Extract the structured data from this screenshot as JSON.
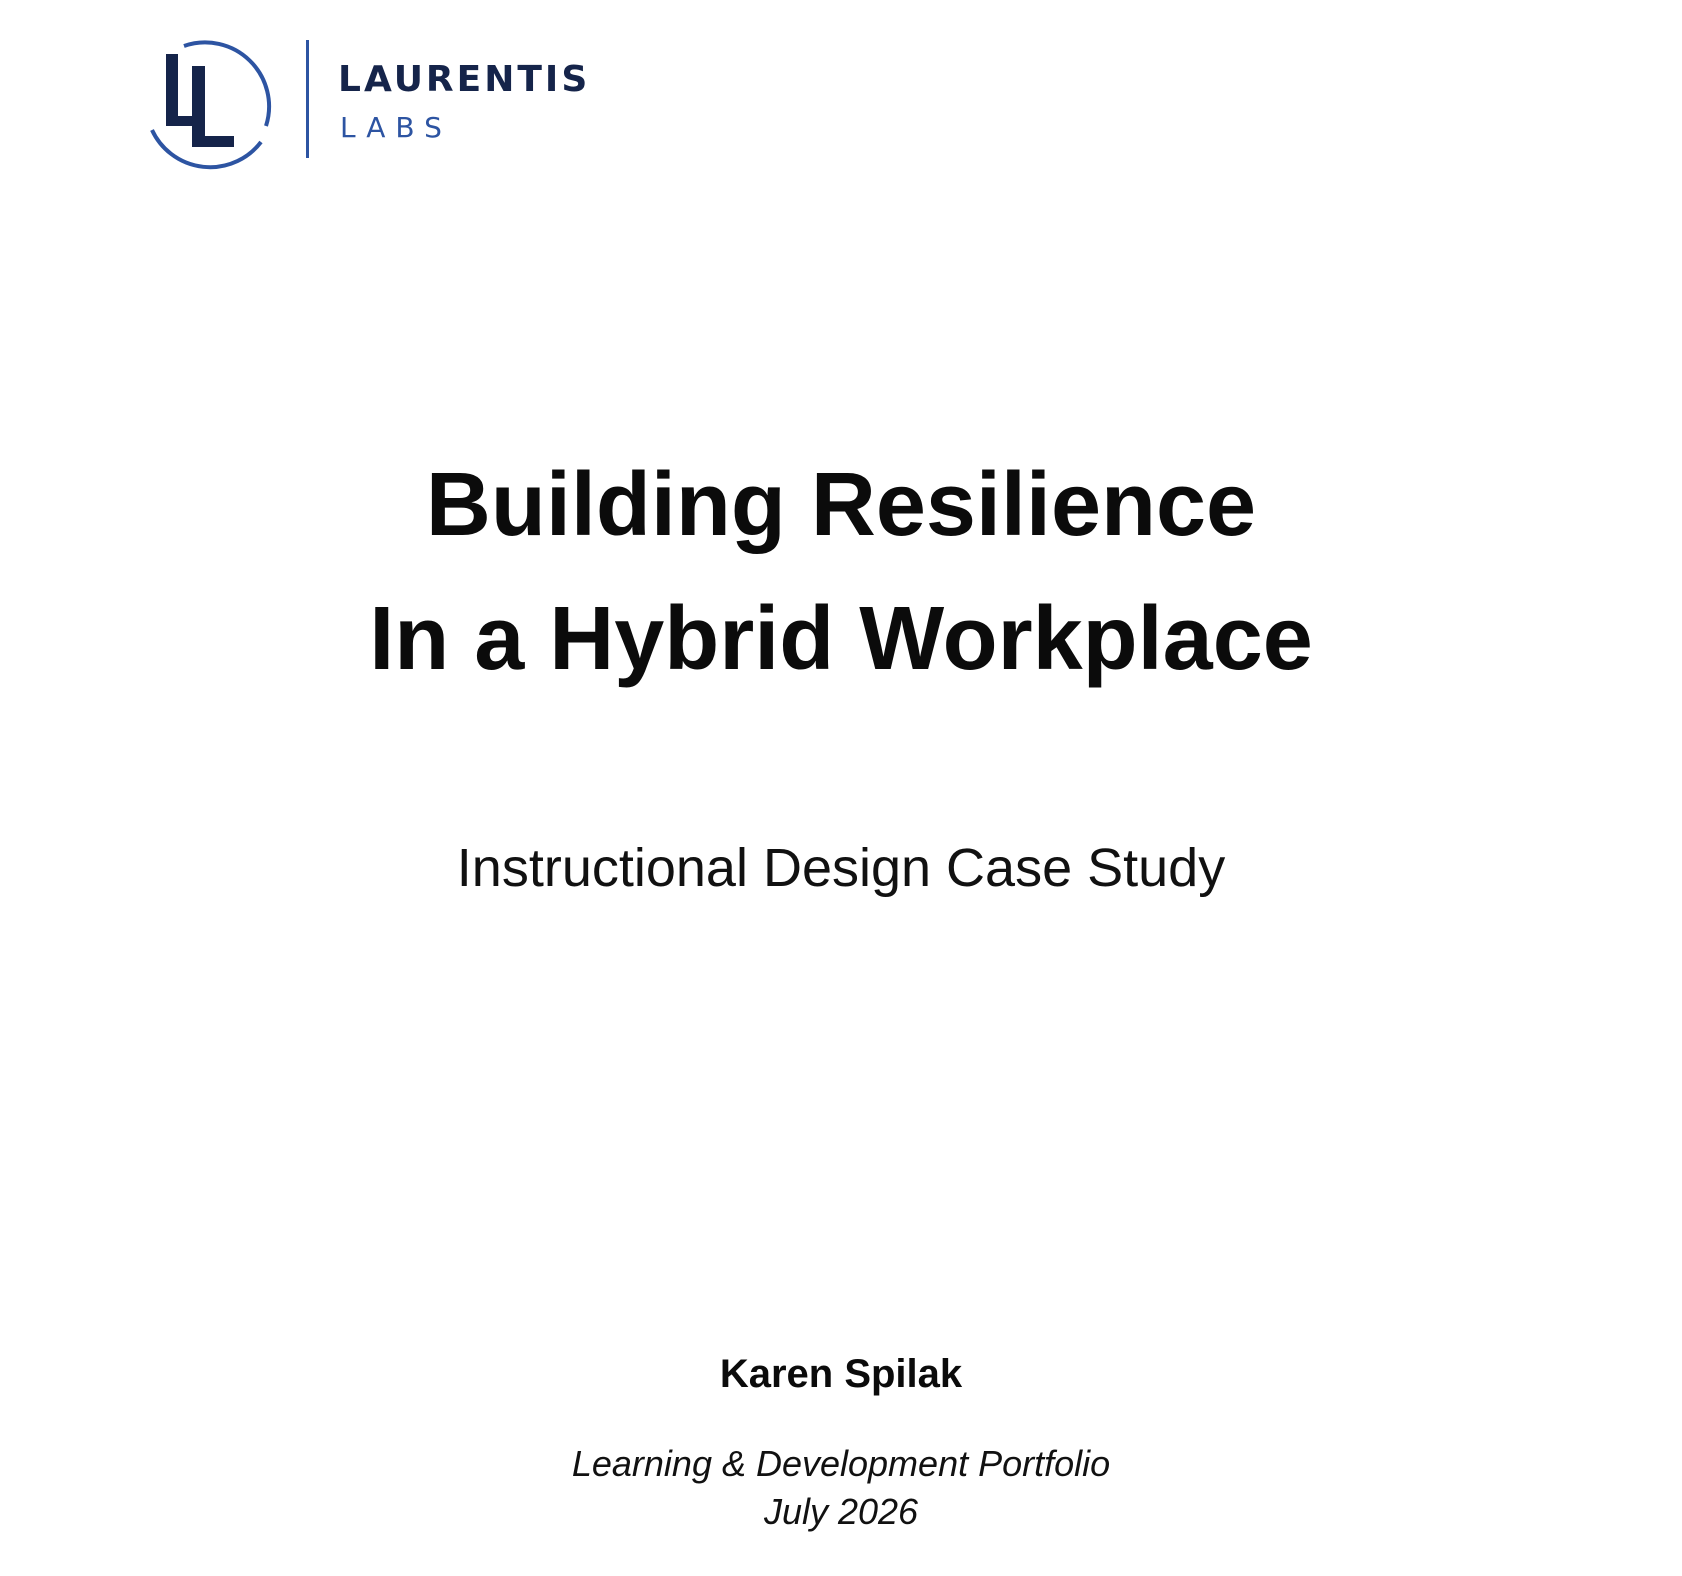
{
  "brand": {
    "name": "LAURENTIS",
    "sub": "LABS",
    "colors": {
      "navy": "#15244a",
      "blue": "#2d54a2"
    },
    "logo_icon": "ll-monogram-icon"
  },
  "cover": {
    "title_line1": "Building Resilience",
    "title_line2": "In a Hybrid Workplace",
    "subtitle": "Instructional Design Case Study",
    "author": "Karen Spilak",
    "portfolio": "Learning & Development Portfolio",
    "date": "July 2026"
  }
}
